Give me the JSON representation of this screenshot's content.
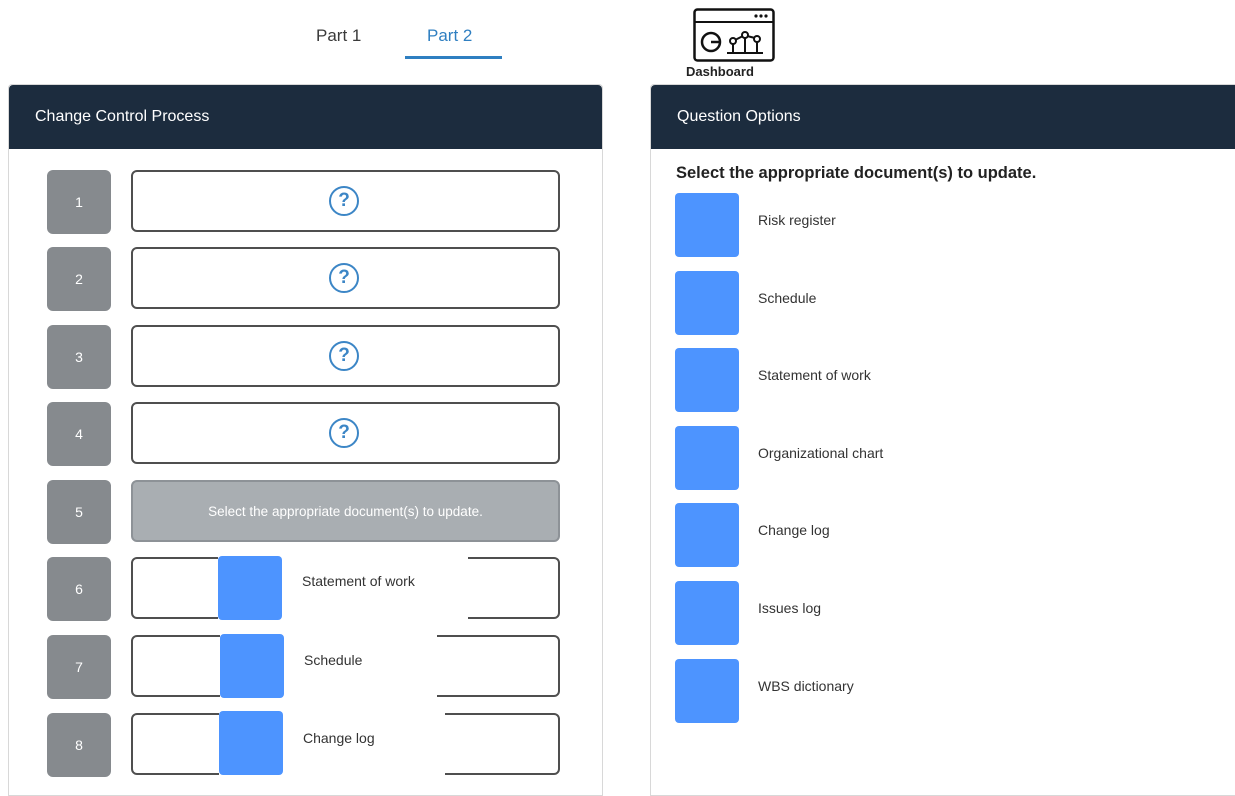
{
  "tabs": [
    {
      "label": "Part 1",
      "active": false
    },
    {
      "label": "Part 2",
      "active": true
    }
  ],
  "dashboard": {
    "label": "Dashboard",
    "icon": "dashboard-icon"
  },
  "left_panel": {
    "title": "Change Control Process",
    "rows": [
      {
        "number": "1",
        "state": "empty"
      },
      {
        "number": "2",
        "state": "empty"
      },
      {
        "number": "3",
        "state": "empty"
      },
      {
        "number": "4",
        "state": "empty"
      },
      {
        "number": "5",
        "state": "prompt",
        "text": "Select the appropriate document(s) to update."
      },
      {
        "number": "6",
        "state": "filled",
        "item": "Statement of work"
      },
      {
        "number": "7",
        "state": "filled",
        "item": "Schedule"
      },
      {
        "number": "8",
        "state": "filled",
        "item": "Change log"
      }
    ],
    "placeholder_icon": "?"
  },
  "right_panel": {
    "title": "Question Options",
    "question": "Select the appropriate document(s) to update.",
    "options": [
      "Risk register",
      "Schedule",
      "Statement of work",
      "Organizational chart",
      "Change log",
      "Issues log",
      "WBS dictionary"
    ]
  },
  "colors": {
    "header_bg": "#1c2c3e",
    "accent_blue": "#2f7fc1",
    "option_blue": "#4d94ff",
    "row_number_bg": "#868a8e",
    "prompt_bg": "#a9aeb2"
  }
}
